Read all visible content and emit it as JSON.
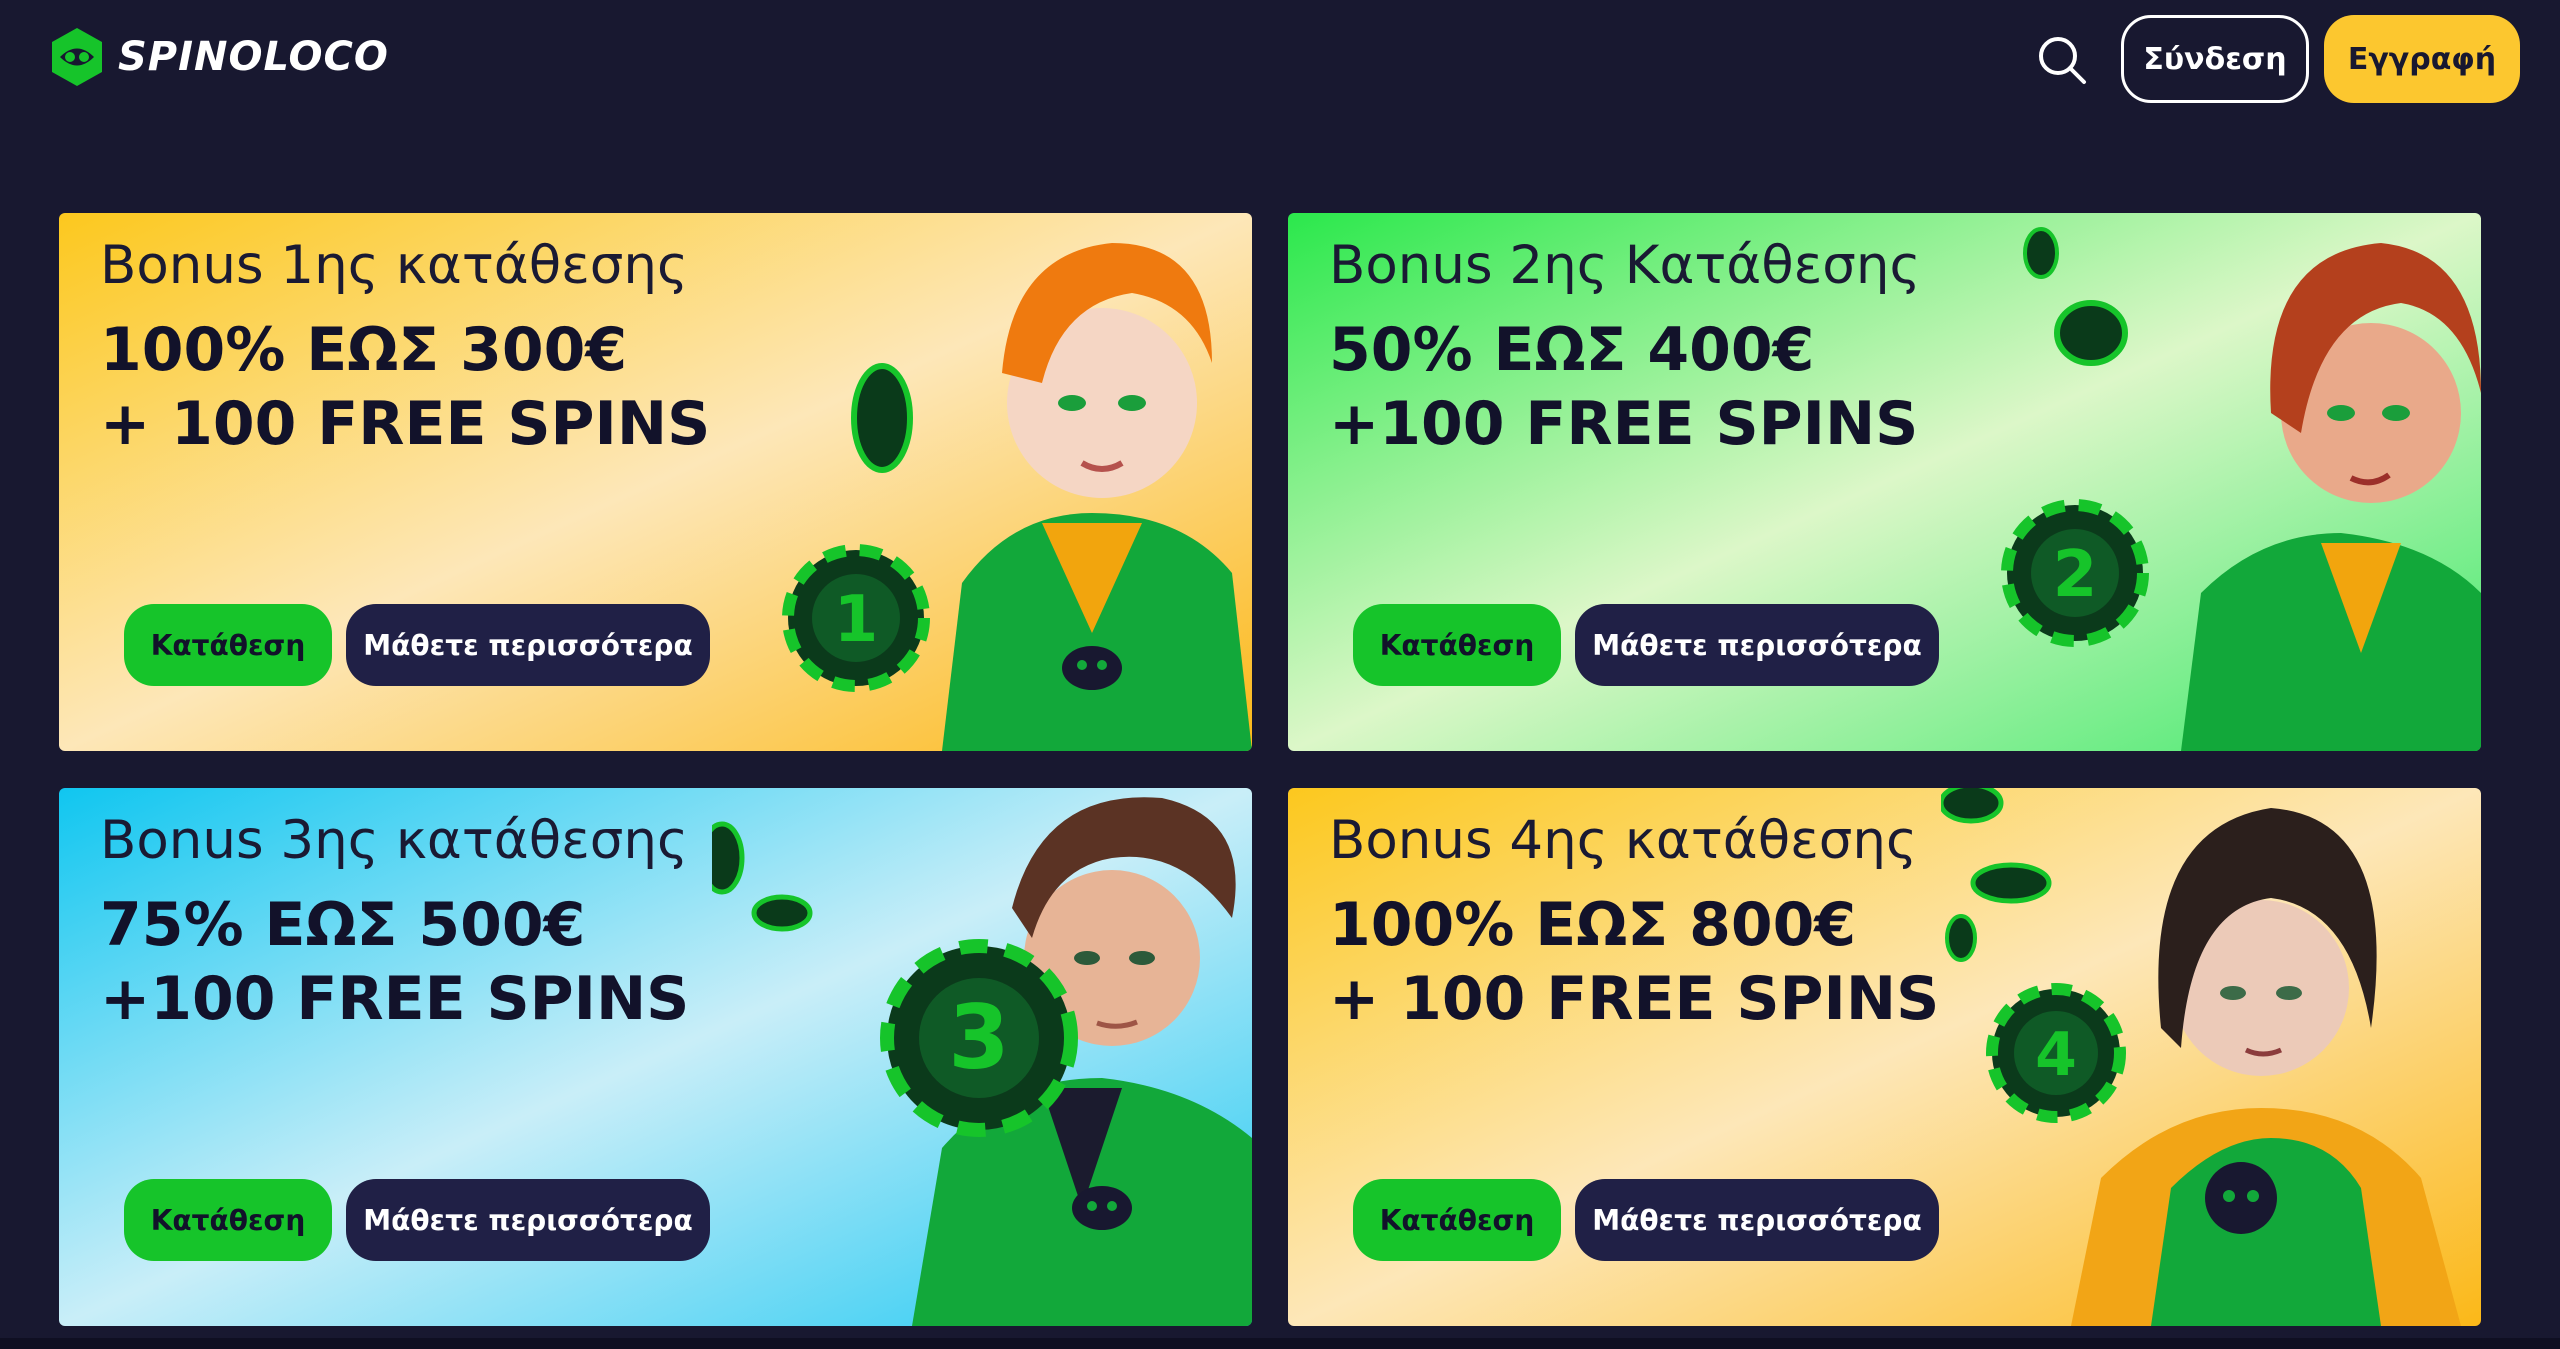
{
  "header": {
    "logo_text": "SPINOLOCO",
    "search_icon": "search-icon",
    "login_label": "Σύνδεση",
    "register_label": "Εγγραφή"
  },
  "colors": {
    "background": "#181830",
    "brand_green": "#16c42a",
    "brand_yellow": "#fcc72f",
    "navy_button": "#202046"
  },
  "promos": [
    {
      "title": "Bonus 1ης κατάθεσης",
      "offer_line1": "100% ΕΩΣ 300€",
      "offer_line2": "+ 100 FREE SPINS",
      "deposit_label": "Κατάθεση",
      "more_label": "Μάθετε περισσότερα",
      "chip_number": "1",
      "theme": "yellow"
    },
    {
      "title": "Bonus 2ης Κατάθεσης",
      "offer_line1": "50% ΕΩΣ 400€",
      "offer_line2": "+100 FREE SPINS",
      "deposit_label": "Κατάθεση",
      "more_label": "Μάθετε περισσότερα",
      "chip_number": "2",
      "theme": "green"
    },
    {
      "title": "Bonus 3ης κατάθεσης",
      "offer_line1": "75% ΕΩΣ 500€",
      "offer_line2": "+100 FREE SPINS",
      "deposit_label": "Κατάθεση",
      "more_label": "Μάθετε περισσότερα",
      "chip_number": "3",
      "theme": "blue"
    },
    {
      "title": "Bonus 4ης κατάθεσης",
      "offer_line1": "100% ΕΩΣ 800€",
      "offer_line2": "+ 100 FREE SPINS",
      "deposit_label": "Κατάθεση",
      "more_label": "Μάθετε περισσότερα",
      "chip_number": "4",
      "theme": "yellow"
    }
  ]
}
